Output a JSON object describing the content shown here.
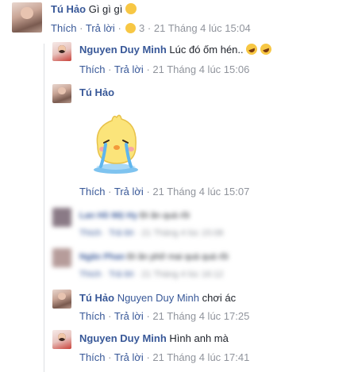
{
  "top_comment": {
    "author": "Tú Hảo",
    "text": "Gì gì gì",
    "emoji_icon": "tired-face-emoji",
    "actions": {
      "like": "Thích",
      "reply": "Trả lời"
    },
    "reaction_count": "3",
    "reaction_icon": "laughing-emoji",
    "time": "21 Tháng 4 lúc 15:04"
  },
  "replies": [
    {
      "author": "Nguyen Duy Minh",
      "text": "Lúc đó ốm hén..",
      "emoji_icon": "rolling-laughing-emoji",
      "time": "21 Tháng 4 lúc 15:06"
    },
    {
      "author": "Tú Hảo",
      "sticker": "crying-chick-sticker",
      "time": "21 Tháng 4 lúc 15:07"
    },
    {
      "author": "Lan Hồ Mộ Hy",
      "text": "Đi ăn quá rồi",
      "time": "21 Tháng 4 lúc 15:08",
      "blurred": true
    },
    {
      "author": "Ngân Phan",
      "text": "Đi ăn phở mai quá quá rồi",
      "time": "21 Tháng 4 lúc 16:12",
      "blurred": true
    },
    {
      "author": "Tú Hảo",
      "mention": "Nguyen Duy Minh",
      "text": "chơi ác",
      "time": "21 Tháng 4 lúc 17:25"
    },
    {
      "author": "Nguyen Duy Minh",
      "text": "Hình anh mà",
      "time": "21 Tháng 4 lúc 17:41"
    }
  ],
  "actions": {
    "like": "Thích",
    "reply": "Trả lời",
    "separator": "·"
  }
}
